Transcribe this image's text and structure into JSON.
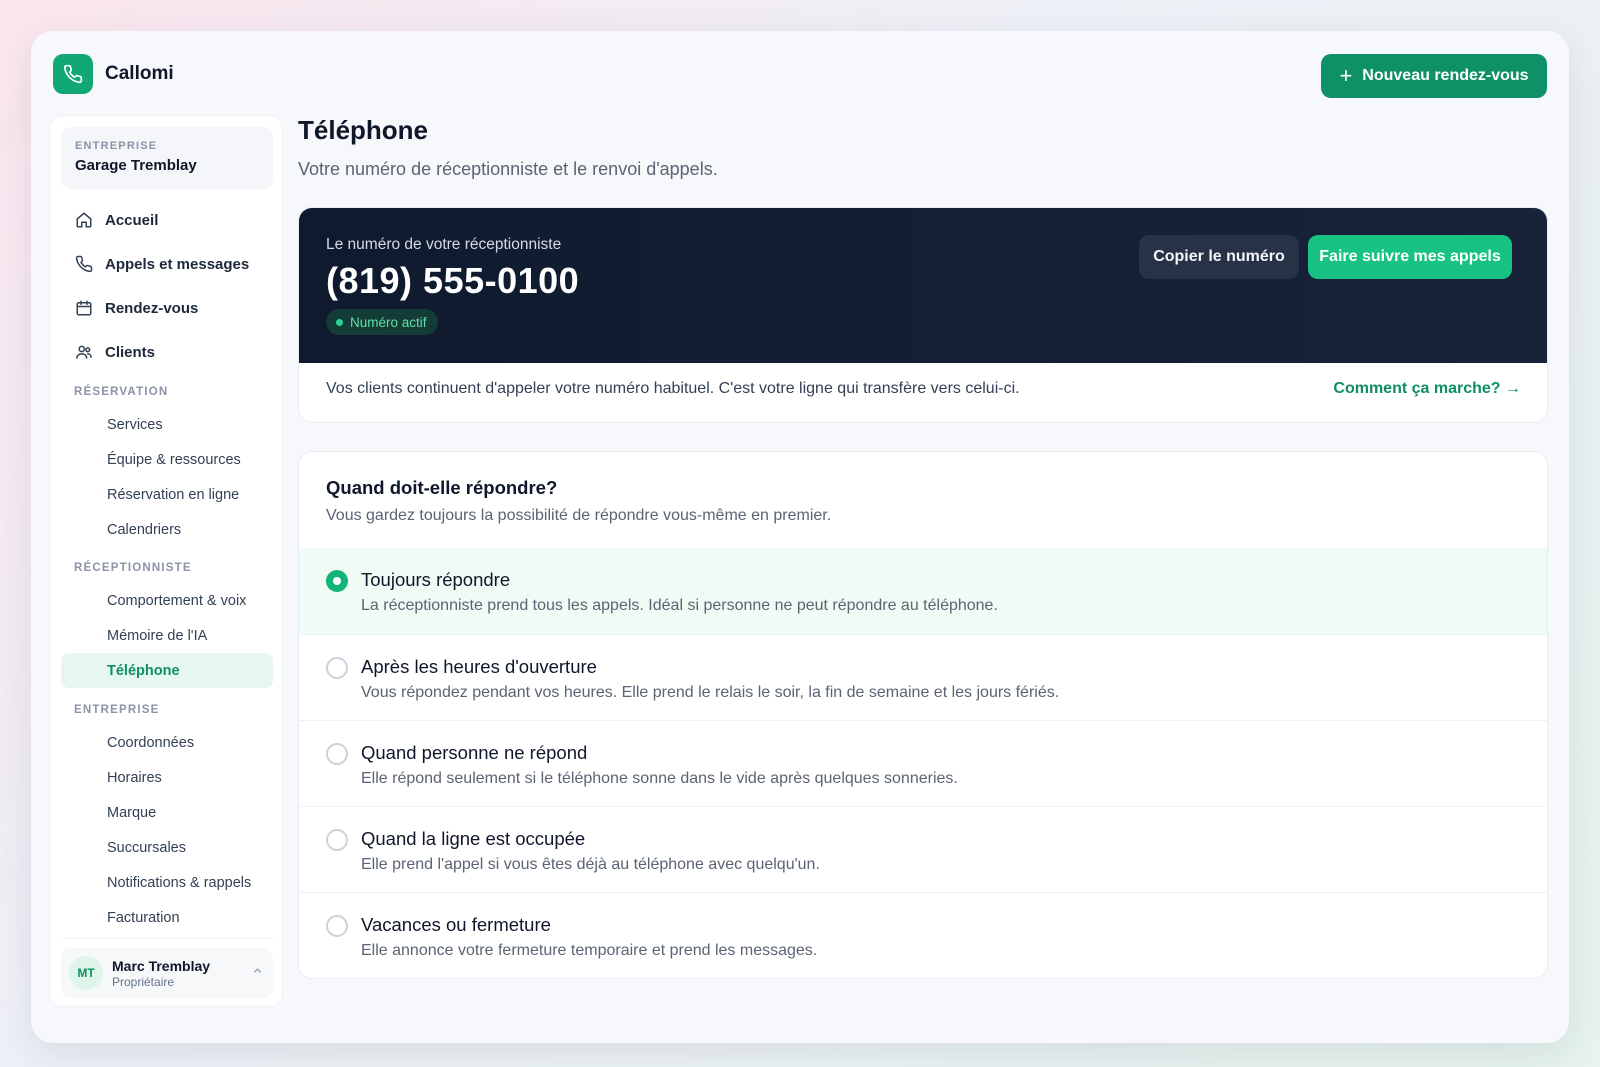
{
  "app": {
    "name": "Callomi",
    "new_button_label": "Nouveau rendez-vous"
  },
  "sidebar": {
    "company_label": "ENTREPRISE",
    "company_name": "Garage Tremblay",
    "main_items": [
      {
        "label": "Accueil",
        "icon": "home-icon"
      },
      {
        "label": "Appels et messages",
        "icon": "phone-icon"
      },
      {
        "label": "Rendez-vous",
        "icon": "calendar-icon"
      },
      {
        "label": "Clients",
        "icon": "users-icon"
      }
    ],
    "sections": [
      {
        "label": "RÉSERVATION",
        "items": [
          "Services",
          "Équipe & ressources",
          "Réservation en ligne",
          "Calendriers"
        ]
      },
      {
        "label": "RÉCEPTIONNISTE",
        "items": [
          "Comportement & voix",
          "Mémoire de l'IA",
          "Téléphone"
        ]
      },
      {
        "label": "ENTREPRISE",
        "items": [
          "Coordonnées",
          "Horaires",
          "Marque",
          "Succursales",
          "Notifications & rappels",
          "Facturation"
        ]
      }
    ],
    "active_item": "Téléphone",
    "user": {
      "initials": "MT",
      "name": "Marc Tremblay",
      "role": "Propriétaire"
    }
  },
  "page": {
    "title": "Téléphone",
    "subtitle": "Votre numéro de réceptionniste et le renvoi d'appels."
  },
  "phone_card": {
    "label": "Le numéro de votre réceptionniste",
    "number": "(819) 555-0100",
    "status": "Numéro actif",
    "copy_label": "Copier le numéro",
    "forward_label": "Faire suivre mes appels",
    "note": "Vos clients continuent d'appeler votre numéro habituel. C'est votre ligne qui transfère vers celui-ci.",
    "help_link": "Comment ça marche? →"
  },
  "options": {
    "title": "Quand doit-elle répondre?",
    "subtitle": "Vous gardez toujours la possibilité de répondre vous-même en premier.",
    "selected_index": 0,
    "items": [
      {
        "title": "Toujours répondre",
        "desc": "La réceptionniste prend tous les appels. Idéal si personne ne peut répondre au téléphone."
      },
      {
        "title": "Après les heures d'ouverture",
        "desc": "Vous répondez pendant vos heures. Elle prend le relais le soir, la fin de semaine et les jours fériés."
      },
      {
        "title": "Quand personne ne répond",
        "desc": "Elle répond seulement si le téléphone sonne dans le vide après quelques sonneries."
      },
      {
        "title": "Quand la ligne est occupée",
        "desc": "Elle prend l'appel si vous êtes déjà au téléphone avec quelqu'un."
      },
      {
        "title": "Vacances ou fermeture",
        "desc": "Elle annonce votre fermeture temporaire et prend les messages."
      }
    ]
  },
  "colors": {
    "brand": "#12a876",
    "primary_button": "#0e9166",
    "accent_green": "#17c283",
    "dark_panel": "#0f1a2e"
  }
}
